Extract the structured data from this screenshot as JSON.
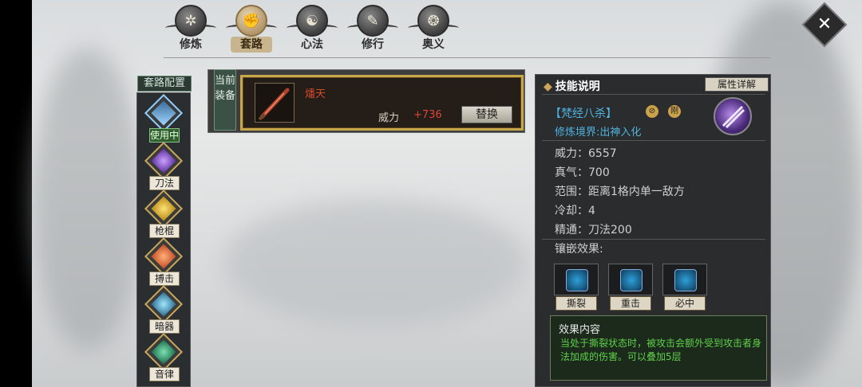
{
  "tabs": [
    {
      "label": "修炼",
      "icon": "cultivation-emblem-icon",
      "active": false
    },
    {
      "label": "套路",
      "icon": "fist-emblem-icon",
      "active": true
    },
    {
      "label": "心法",
      "icon": "heart-method-emblem-icon",
      "active": false
    },
    {
      "label": "修行",
      "icon": "practice-emblem-icon",
      "active": false
    },
    {
      "label": "奥义",
      "icon": "mystery-emblem-icon",
      "active": false
    }
  ],
  "sidebar": {
    "title": "套路配置",
    "categories": [
      {
        "label": "使用中",
        "icon": "in-use-gem-icon",
        "active": true
      },
      {
        "label": "刀法",
        "icon": "blade-gem-icon",
        "active": false
      },
      {
        "label": "枪棍",
        "icon": "spear-gem-icon",
        "active": false
      },
      {
        "label": "搏击",
        "icon": "fist-gem-icon",
        "active": false
      },
      {
        "label": "暗器",
        "icon": "hidden-weapon-gem-icon",
        "active": false
      },
      {
        "label": "音律",
        "icon": "music-gem-icon",
        "active": false
      }
    ]
  },
  "equipment": {
    "side_label": "当前装备",
    "name": "燔天",
    "power_label": "威力",
    "power_bonus": "+736",
    "replace_button": "替换"
  },
  "skill_panel": {
    "title": "技能说明",
    "attr_button": "属性详解",
    "skill_name": "【梵经八杀】",
    "badge_label": "刚",
    "realm": "修炼境界:出神入化",
    "stats": [
      {
        "label": "威力",
        "value": "6557"
      },
      {
        "label": "真气",
        "value": "700"
      },
      {
        "label": "范围",
        "value": "距离1格内单一敌方"
      },
      {
        "label": "冷却",
        "value": "4"
      },
      {
        "label": "精通",
        "value": "刀法200"
      }
    ],
    "inlay_label": "镶嵌效果:",
    "inlays": [
      {
        "label": "撕裂",
        "icon": "tear-icon"
      },
      {
        "label": "重击",
        "icon": "heavy-strike-icon"
      },
      {
        "label": "必中",
        "icon": "sure-hit-icon"
      }
    ],
    "effect_title": "效果内容",
    "effect_text": "当处于撕裂状态时，被攻击会额外受到攻击者身法加成的伤害。可以叠加5层"
  },
  "colors": {
    "gold": "#c8a64a",
    "skill_blue": "#4fb3e0",
    "effect_green": "#5ed04a",
    "bonus_red": "#e0443a"
  }
}
